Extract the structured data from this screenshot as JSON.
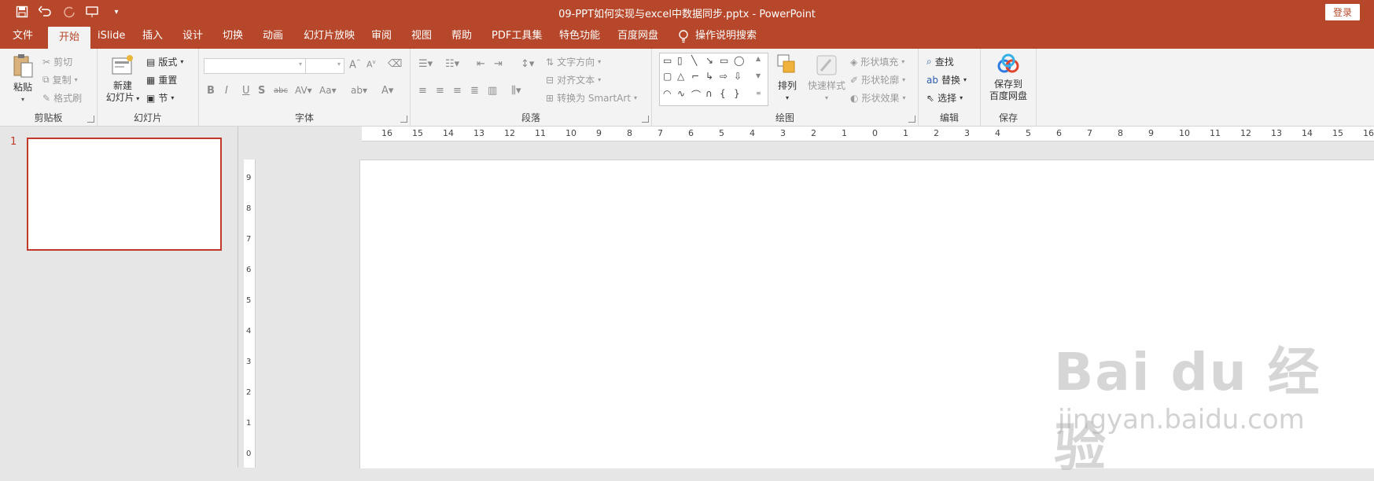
{
  "window": {
    "title": "09-PPT如何实现与excel中数据同步.pptx  -  PowerPoint",
    "login_label": "登录"
  },
  "qat": {
    "icons": [
      "save-icon",
      "undo-icon",
      "redo-icon",
      "start-from-beginning-icon",
      "customize-qat-icon"
    ]
  },
  "tabs": [
    {
      "label": "文件"
    },
    {
      "label": "开始"
    },
    {
      "label": "iSlide"
    },
    {
      "label": "插入"
    },
    {
      "label": "设计"
    },
    {
      "label": "切换"
    },
    {
      "label": "动画"
    },
    {
      "label": "幻灯片放映"
    },
    {
      "label": "审阅"
    },
    {
      "label": "视图"
    },
    {
      "label": "帮助"
    },
    {
      "label": "PDF工具集"
    },
    {
      "label": "特色功能"
    },
    {
      "label": "百度网盘"
    }
  ],
  "tell_me": "操作说明搜索",
  "ribbon": {
    "clipboard": {
      "label": "剪贴板",
      "paste": "粘贴",
      "cut": "剪切",
      "copy": "复制",
      "format_painter": "格式刷"
    },
    "slides": {
      "label": "幻灯片",
      "new_slide_line1": "新建",
      "new_slide_line2": "幻灯片",
      "layout": "版式",
      "reset": "重置",
      "section": "节"
    },
    "font": {
      "label": "字体"
    },
    "paragraph": {
      "label": "段落",
      "text_direction": "文字方向",
      "align_text": "对齐文本",
      "smartart": "转换为 SmartArt"
    },
    "drawing": {
      "label": "绘图",
      "arrange": "排列",
      "quick_styles": "快速样式",
      "shape_fill": "形状填充",
      "shape_outline": "形状轮廓",
      "shape_effects": "形状效果"
    },
    "editing": {
      "label": "编辑",
      "find": "查找",
      "replace": "替换",
      "select": "选择"
    },
    "save": {
      "label": "保存",
      "save_to_line1": "保存到",
      "save_to_line2": "百度网盘"
    }
  },
  "thumbnail": {
    "number": "1"
  },
  "hruler_ticks": [
    "16",
    "15",
    "14",
    "13",
    "12",
    "11",
    "10",
    "9",
    "8",
    "7",
    "6",
    "5",
    "4",
    "3",
    "2",
    "1",
    "0",
    "1",
    "2",
    "3",
    "4",
    "5",
    "6",
    "7",
    "8",
    "9",
    "10",
    "11",
    "12",
    "13",
    "14",
    "15",
    "16"
  ],
  "vruler_ticks": [
    "9",
    "8",
    "7",
    "6",
    "5",
    "4",
    "3",
    "2",
    "1",
    "0"
  ],
  "watermark": {
    "brand": "Bai du 经验",
    "url": "jingyan.baidu.com"
  }
}
